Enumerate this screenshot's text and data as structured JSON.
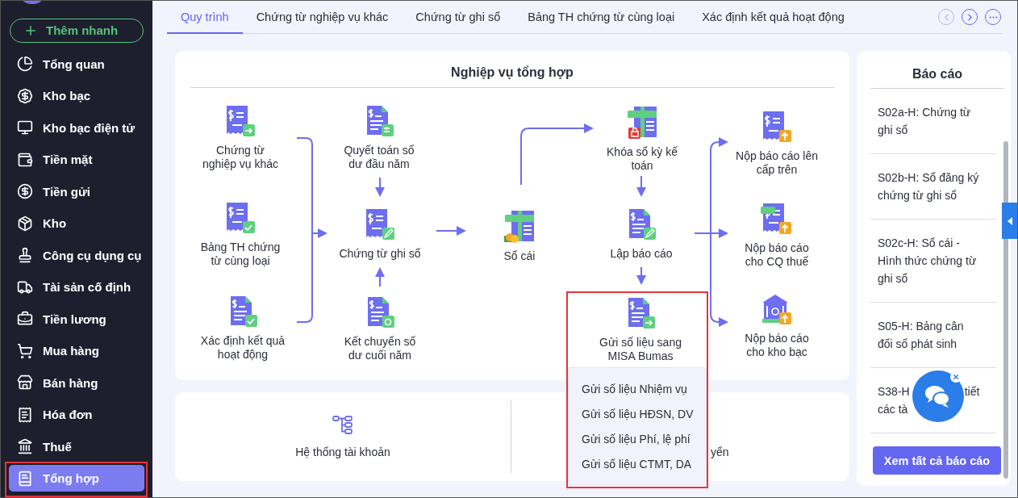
{
  "sidebar": {
    "quick_add": "Thêm nhanh",
    "items": [
      {
        "label": "Tổng quan",
        "selected": false,
        "highlighted": false
      },
      {
        "label": "Kho bạc",
        "selected": false,
        "highlighted": false
      },
      {
        "label": "Kho bạc điện tử",
        "selected": false,
        "highlighted": false
      },
      {
        "label": "Tiền mặt",
        "selected": false,
        "highlighted": false
      },
      {
        "label": "Tiền gửi",
        "selected": false,
        "highlighted": false
      },
      {
        "label": "Kho",
        "selected": false,
        "highlighted": false
      },
      {
        "label": "Công cụ dụng cụ",
        "selected": false,
        "highlighted": false
      },
      {
        "label": "Tài sản cố định",
        "selected": false,
        "highlighted": false
      },
      {
        "label": "Tiền lương",
        "selected": false,
        "highlighted": false
      },
      {
        "label": "Mua hàng",
        "selected": false,
        "highlighted": false
      },
      {
        "label": "Bán hàng",
        "selected": false,
        "highlighted": false
      },
      {
        "label": "Hóa đơn",
        "selected": false,
        "highlighted": false
      },
      {
        "label": "Thuế",
        "selected": false,
        "highlighted": false
      },
      {
        "label": "Tổng hợp",
        "selected": true,
        "highlighted": true
      }
    ]
  },
  "tabs": [
    {
      "label": "Quy trình",
      "selected": true
    },
    {
      "label": "Chứng từ nghiệp vụ khác",
      "selected": false
    },
    {
      "label": "Chứng từ ghi sổ",
      "selected": false
    },
    {
      "label": "Bảng TH chứng từ cùng loại",
      "selected": false
    },
    {
      "label": "Xác định kết quả hoạt động",
      "selected": false
    }
  ],
  "flow": {
    "title": "Nghiệp vụ tổng hợp",
    "nodes": [
      {
        "lines": [
          "Chứng từ",
          "nghiệp vụ khác"
        ],
        "highlighted": false
      },
      {
        "lines": [
          "Quyết toán số",
          "dư đầu năm"
        ],
        "highlighted": false
      },
      {
        "lines": [
          "Khóa sổ kỳ kế",
          "toán"
        ],
        "highlighted": false
      },
      {
        "lines": [
          "Nộp báo cáo lên",
          "cấp trên"
        ],
        "highlighted": false
      },
      {
        "lines": [
          "Bảng TH chứng",
          "từ cùng loại"
        ],
        "highlighted": false
      },
      {
        "lines": [
          "Chứng từ ghi sổ"
        ],
        "highlighted": false
      },
      {
        "lines": [
          "Sổ cái"
        ],
        "highlighted": false
      },
      {
        "lines": [
          "Lập báo cáo"
        ],
        "highlighted": false
      },
      {
        "lines": [
          "Nộp báo cáo",
          "cho CQ thuế"
        ],
        "highlighted": false
      },
      {
        "lines": [
          "Xác định kết quả",
          "hoạt động"
        ],
        "highlighted": false
      },
      {
        "lines": [
          "Kết chuyển số",
          "dư cuối năm"
        ],
        "highlighted": false
      },
      {
        "lines": [
          "Gửi số liệu sang",
          "MISA Bumas"
        ],
        "highlighted": true,
        "menu": [
          "Gửi số liệu Nhiệm vụ",
          "Gửi số liệu HĐSN, DV",
          "Gửi số liệu Phí, lệ phí",
          "Gửi số liệu CTMT, DA"
        ]
      },
      {
        "lines": [
          "Nộp báo cáo",
          "cho kho bạc"
        ],
        "highlighted": false
      }
    ]
  },
  "shortcuts": [
    {
      "label": "Hệ thống tài khoản"
    },
    {
      "label": "yển"
    }
  ],
  "reports": {
    "title": "Báo cáo",
    "items": [
      {
        "lines": [
          [
            "S02a-H: Chứng từ"
          ],
          [
            "ghi sổ"
          ]
        ]
      },
      {
        "lines": [
          [
            "S02b-H: Sổ đăng ký"
          ],
          [
            "chứng từ ghi sổ"
          ]
        ]
      },
      {
        "lines": [
          [
            "S02c-H: Sổ cái -"
          ],
          [
            "Hình thức chứng từ"
          ],
          [
            "ghi sổ"
          ]
        ]
      },
      {
        "lines": [
          [
            "S05-H: Bảng cân"
          ],
          [
            "đối số phát sinh"
          ]
        ]
      },
      {
        "lines": [
          [
            "S38-H",
            "tiết"
          ],
          [
            "các tà"
          ]
        ]
      }
    ],
    "button": "Xem tất cả báo cáo"
  }
}
